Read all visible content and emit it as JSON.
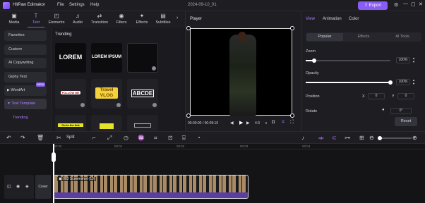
{
  "app": {
    "name": "HitPaw Edimakor",
    "menu": [
      "File",
      "Settings",
      "Help"
    ],
    "doc_title": "2024-09-10_01",
    "export_label": "Export"
  },
  "toolbar": [
    {
      "label": "Media",
      "icon": "media-icon"
    },
    {
      "label": "Text",
      "icon": "text-icon",
      "active": true
    },
    {
      "label": "Elements",
      "icon": "elements-icon"
    },
    {
      "label": "Audio",
      "icon": "audio-icon"
    },
    {
      "label": "Transition",
      "icon": "transition-icon"
    },
    {
      "label": "Filters",
      "icon": "filters-icon"
    },
    {
      "label": "Effects",
      "icon": "effects-icon"
    },
    {
      "label": "Subtitles",
      "icon": "subtitles-icon"
    }
  ],
  "leftnav": {
    "items": [
      {
        "label": "Favorites"
      },
      {
        "label": "Custom"
      },
      {
        "label": "AI Copywriting"
      },
      {
        "label": "Giphy Text"
      },
      {
        "label": "WordArt",
        "badge": "NEW"
      },
      {
        "label": "Text Template"
      },
      {
        "label": "Trending"
      }
    ]
  },
  "trending": {
    "title": "Trending",
    "thumbs": [
      {
        "text": "LOREM"
      },
      {
        "text": "LOREM IPSUM"
      },
      {
        "text": ""
      },
      {
        "text": "FOLLOW ME"
      },
      {
        "text": "Travel VLOG"
      },
      {
        "text": "ABCDE"
      },
      {
        "text": "Go to the link"
      },
      {
        "text": ""
      },
      {
        "text": ""
      }
    ]
  },
  "player": {
    "title": "Player",
    "time": "00:00:00 / 00:09:10",
    "ratio": "4:3"
  },
  "props": {
    "tabs": [
      "View",
      "Animation",
      "Color"
    ],
    "subtabs": [
      "Popular",
      "Effects",
      "AI Tools"
    ],
    "zoom_label": "Zoom",
    "zoom_value": "100%",
    "zoom_level": 0.1,
    "opacity_label": "Opacity",
    "opacity_value": "100%",
    "opacity_level": 1.0,
    "position_label": "Position",
    "x_label": "X",
    "x_value": "0",
    "y_label": "Y",
    "y_value": "0",
    "rotate_label": "Rotate",
    "rotate_value": "0°",
    "reset_label": "Reset"
  },
  "timeline_toolbar": {
    "split_label": "Split"
  },
  "timeline": {
    "ruler": [
      "00:00",
      "00:01",
      "00:02",
      "00:03",
      "00:04"
    ],
    "cover_label": "Cover",
    "clip_label": "003 Screenshot (13)"
  },
  "colors": {
    "accent": "#8a5cf6",
    "clip": "#5a3ea0"
  }
}
